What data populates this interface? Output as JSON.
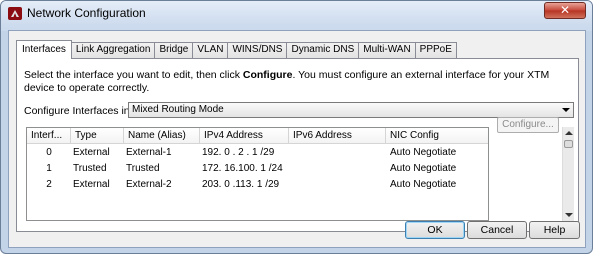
{
  "window": {
    "title": "Network Configuration",
    "close_label": "✕"
  },
  "tabs": [
    {
      "label": "Interfaces",
      "active": true
    },
    {
      "label": "Link Aggregation"
    },
    {
      "label": "Bridge"
    },
    {
      "label": "VLAN"
    },
    {
      "label": "WINS/DNS"
    },
    {
      "label": "Dynamic DNS"
    },
    {
      "label": "Multi-WAN"
    },
    {
      "label": "PPPoE"
    }
  ],
  "description": {
    "before": "Select the interface you want to edit, then click ",
    "bold": "Configure",
    "after": ". You must configure an external interface for your XTM device to operate correctly."
  },
  "configure_interfaces": {
    "label": "Configure Interfaces in",
    "selected": "Mixed Routing Mode"
  },
  "table": {
    "headers": [
      "Interf...",
      "Type",
      "Name (Alias)",
      "IPv4 Address",
      "IPv6 Address",
      "NIC Config"
    ],
    "rows": [
      [
        "0",
        "External",
        "External-1",
        "192. 0 . 2 . 1 /29",
        "",
        "Auto Negotiate"
      ],
      [
        "1",
        "Trusted",
        "Trusted",
        "172. 16.100. 1 /24",
        "",
        "Auto Negotiate"
      ],
      [
        "2",
        "External",
        "External-2",
        "203. 0 .113. 1 /29",
        "",
        "Auto Negotiate"
      ]
    ]
  },
  "buttons": {
    "configure": "Configure...",
    "ok": "OK",
    "cancel": "Cancel",
    "help": "Help"
  }
}
